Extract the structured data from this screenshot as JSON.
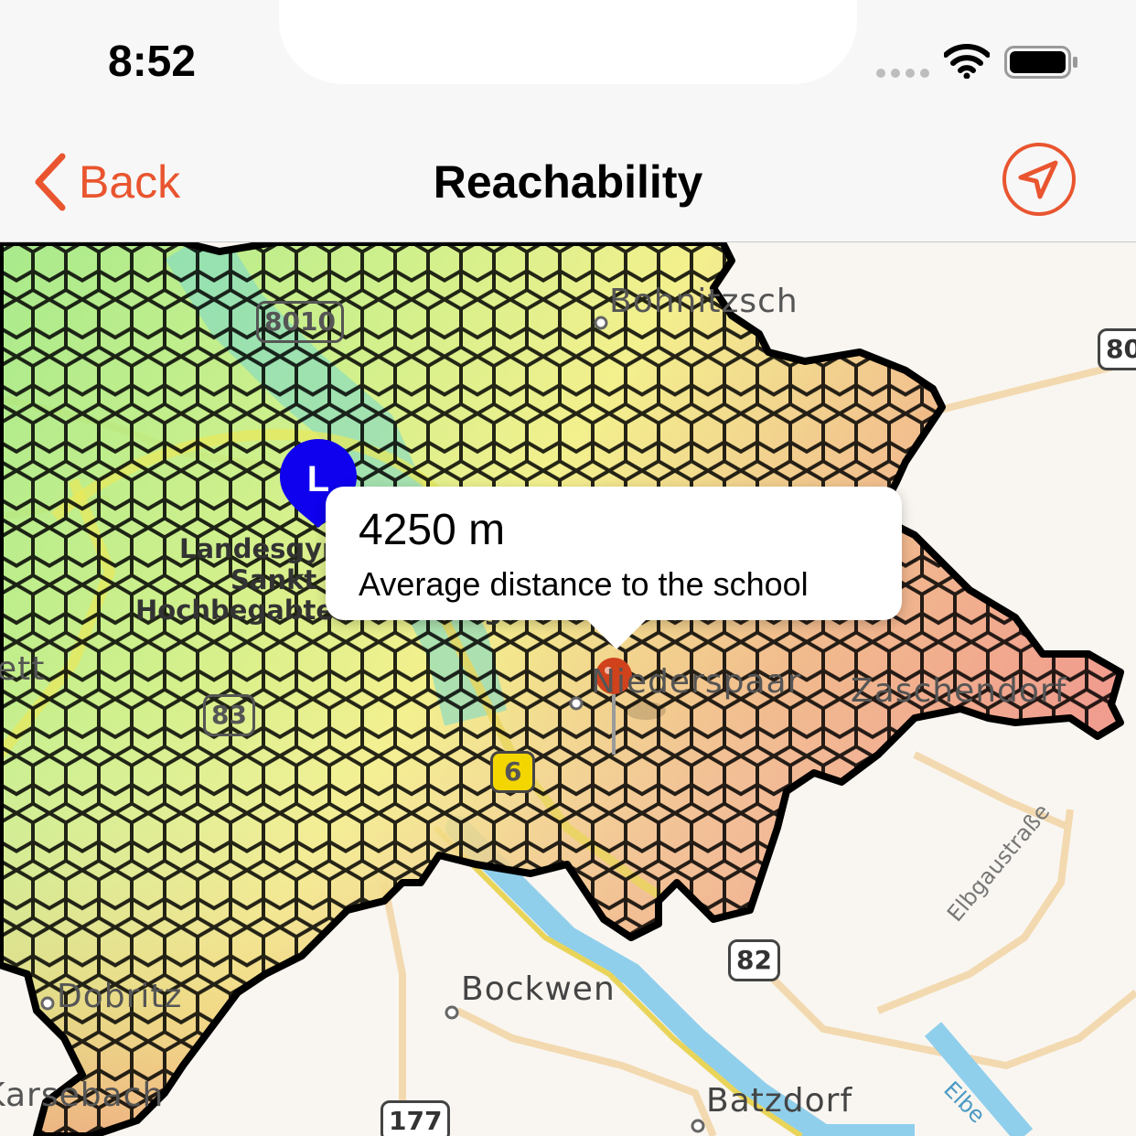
{
  "status_bar": {
    "time": "8:52",
    "icons": [
      "signal-dots-icon",
      "wifi-icon",
      "battery-icon"
    ]
  },
  "nav_bar": {
    "back_label": "Back",
    "title": "Reachability",
    "locate_icon": "location-arrow-icon",
    "accent_color": "#e9552f"
  },
  "map": {
    "place_labels": {
      "bohnitzsch": "Bohnitzsch",
      "landesgym_line1": "Landesgymnasium",
      "landesgym_line2": "Sankt Afra",
      "landesgym_line3": "Hochbegabtenförderung",
      "niederspaar": "Niederspaar",
      "zaschendorf": "Zaschendorf",
      "bockwen": "Bockwen",
      "batzdorf": "Batzdorf",
      "dobritz": "Dobritz",
      "karsebach": "Karsebach",
      "left_edge": "ett",
      "elbgaustrasse": "Elbgaustraße",
      "elbe": "Elbe"
    },
    "road_shields": {
      "s8010": "8010",
      "s80": "80",
      "s83": "83",
      "s6": "6",
      "s82": "82",
      "s177": "177"
    },
    "school_marker_letter": "L",
    "heat_colors": {
      "near": "#9ae87a",
      "mid": "#f2ef7c",
      "far": "#f0b27d",
      "farthest": "#ef8b7c"
    }
  },
  "callout": {
    "value": "4250 m",
    "description": "Average distance to the school"
  }
}
